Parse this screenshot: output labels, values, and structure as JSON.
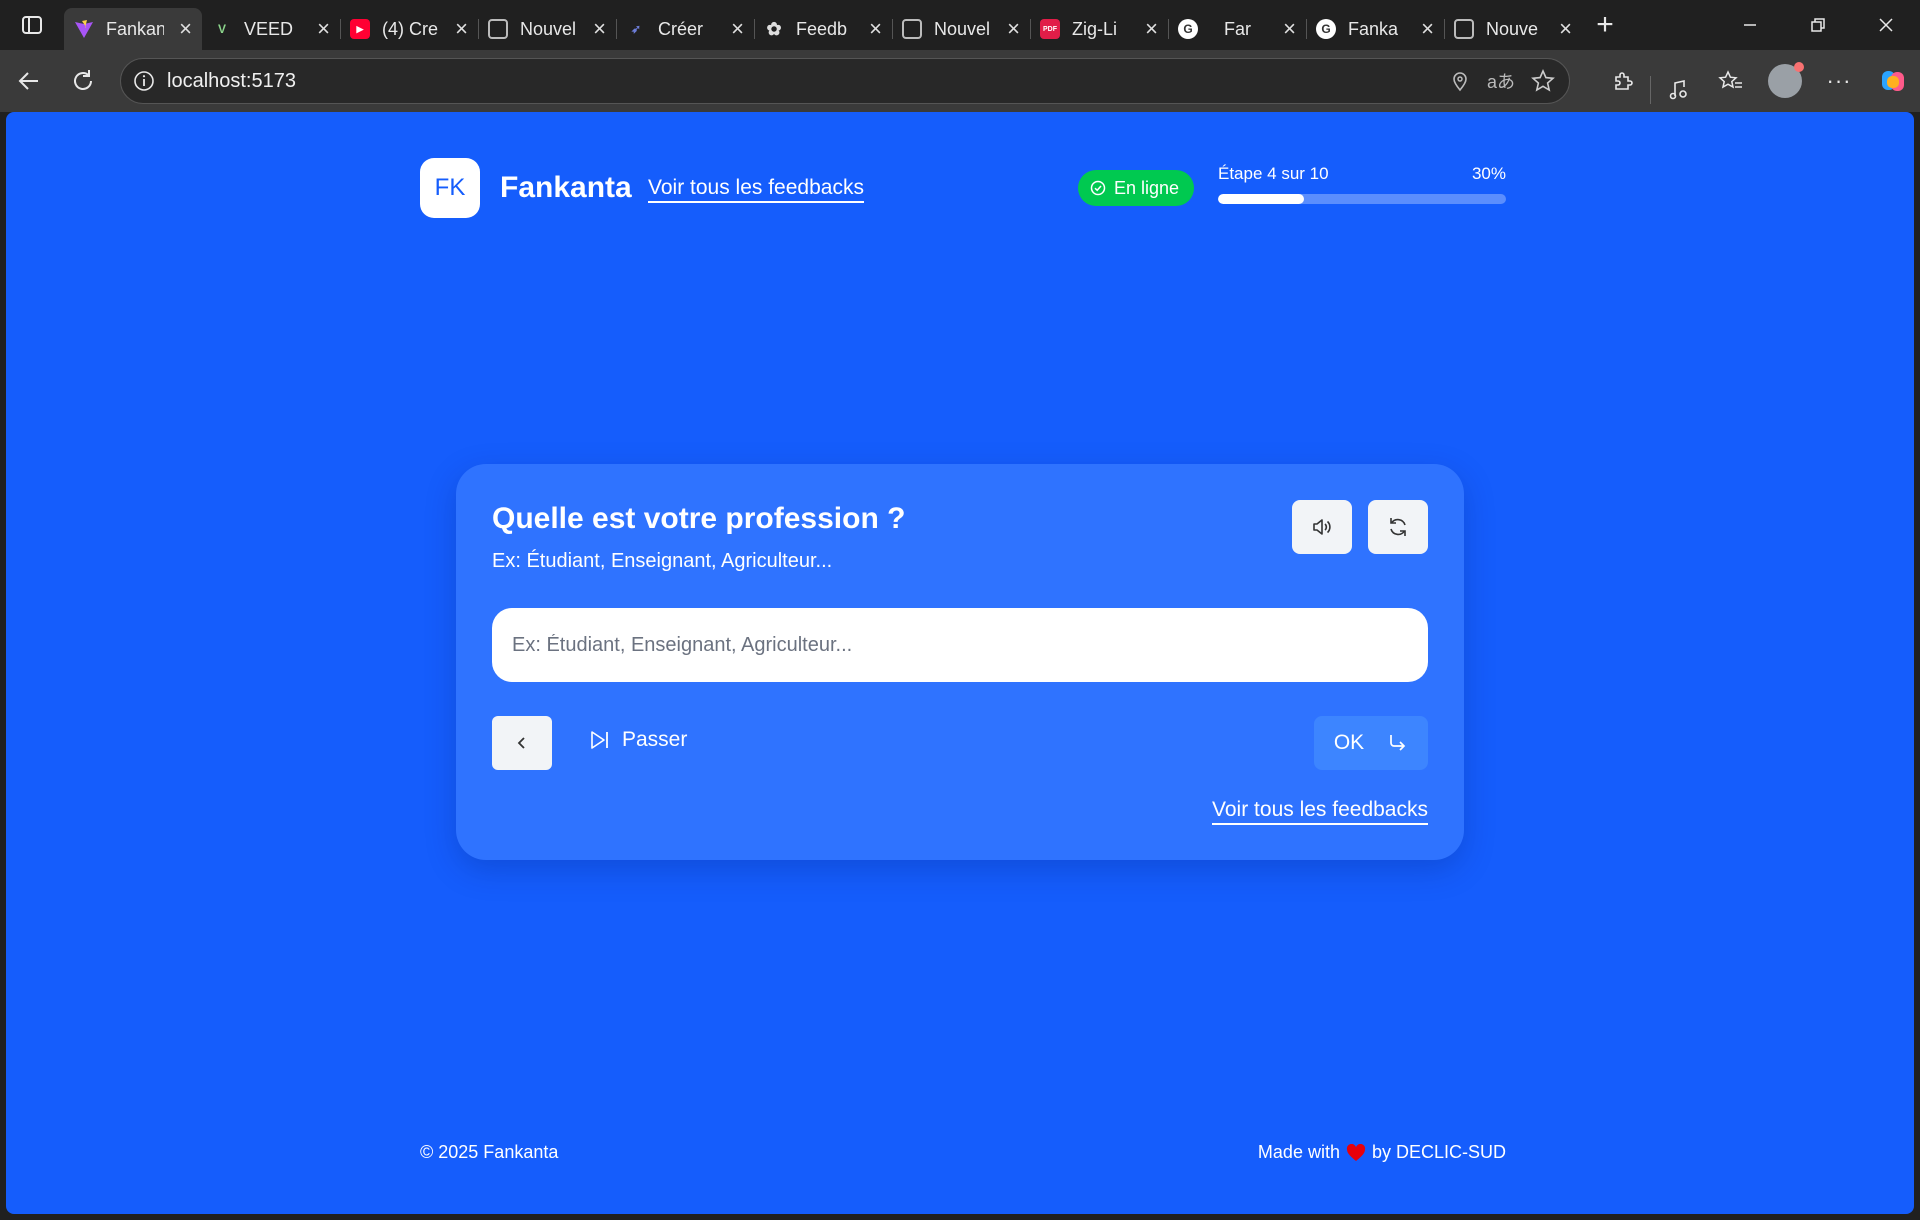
{
  "browser": {
    "tabs": [
      {
        "title": "Fankanta",
        "favicon": "vite-icon",
        "active": true
      },
      {
        "title": "VEED",
        "favicon": "veed-icon"
      },
      {
        "title": "(4) Cre",
        "favicon": "youtube-icon"
      },
      {
        "title": "Nouvel",
        "favicon": "page-icon"
      },
      {
        "title": "Créer",
        "favicon": "bird-icon"
      },
      {
        "title": "Feedb",
        "favicon": "openai-icon"
      },
      {
        "title": "Nouvel",
        "favicon": "page-icon"
      },
      {
        "title": "Zig-Li",
        "favicon": "pdf-icon"
      },
      {
        "title": "Far",
        "favicon": "google-icon"
      },
      {
        "title": "Fanka",
        "favicon": "google-icon"
      },
      {
        "title": "Nouve",
        "favicon": "page-icon"
      }
    ],
    "url": "localhost:5173"
  },
  "header": {
    "logo": "FK",
    "brand": "Fankanta",
    "link": "Voir tous les feedbacks",
    "status": "En ligne",
    "step": "Étape 4 sur 10",
    "percent_label": "30%",
    "progress_fraction": 0.3
  },
  "question": {
    "title": "Quelle est votre profession ?",
    "subtitle": "Ex: Étudiant, Enseignant, Agriculteur...",
    "placeholder": "Ex: Étudiant, Enseignant, Agriculteur...",
    "value": "",
    "skip_label": "Passer",
    "ok_label": "OK",
    "link": "Voir tous les feedbacks"
  },
  "footer": {
    "copyright": "© 2025 Fankanta",
    "made_with": "Made with",
    "by": "by DECLIC-SUD"
  },
  "colors": {
    "page_bg": "#155dfc",
    "card_bg": "#2f73ff",
    "online": "#00c950",
    "heart": "#e7000b"
  }
}
